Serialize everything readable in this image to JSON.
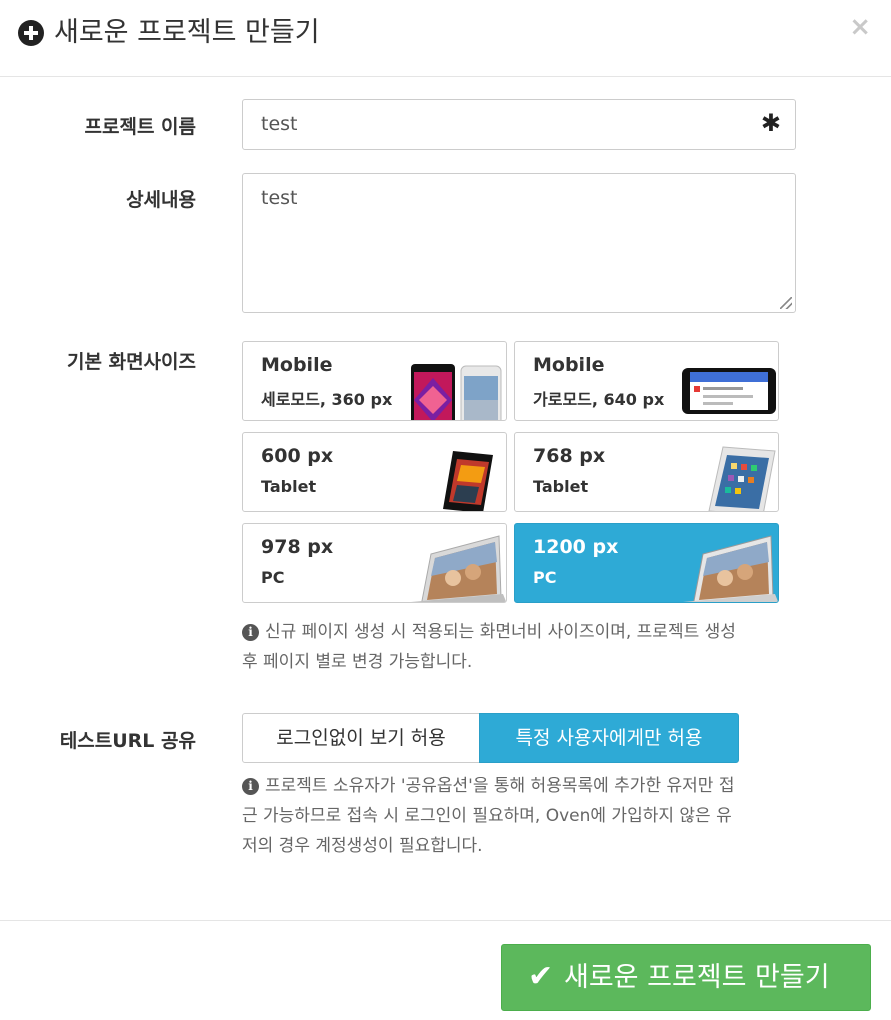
{
  "header": {
    "title": "새로운 프로젝트 만들기",
    "close": "×"
  },
  "fields": {
    "name": {
      "label": "프로젝트 이름",
      "value": "test",
      "required_mark": "✱"
    },
    "description": {
      "label": "상세내용",
      "value": "test"
    }
  },
  "screen_size": {
    "label": "기본 화면사이즈",
    "selected": "1200 px PC",
    "options": [
      {
        "title": "Mobile",
        "sub": "세로모드, 360 px",
        "icon": "phone-portrait-icon"
      },
      {
        "title": "Mobile",
        "sub": "가로모드, 640 px",
        "icon": "phone-landscape-icon"
      },
      {
        "title": "600 px",
        "sub": "Tablet",
        "icon": "tablet-small-icon"
      },
      {
        "title": "768 px",
        "sub": "Tablet",
        "icon": "tablet-icon"
      },
      {
        "title": "978 px",
        "sub": "PC",
        "icon": "laptop-icon"
      },
      {
        "title": "1200 px",
        "sub": "PC",
        "icon": "laptop-icon"
      }
    ],
    "help_lines": [
      "신규 페이지 생성 시 적용되는 화면너비 사이즈이며, 프로젝트 생성",
      "후 페이지 별로 변경 가능합니다."
    ]
  },
  "share": {
    "label": "테스트URL 공유",
    "option_public": "로그인없이 보기 허용",
    "option_restricted": "특정 사용자에게만 허용",
    "selected": "특정 사용자에게만 허용",
    "help_lines": [
      "프로젝트 소유자가 '공유옵션'을 통해 허용목록에 추가한 유저만 접",
      "근 가능하므로 접속 시 로그인이 필요하며, Oven에 가입하지 않은 유",
      "저의 경우 계정생성이 필요합니다."
    ]
  },
  "footer": {
    "submit_label": "새로운 프로젝트 만들기"
  },
  "colors": {
    "accent_blue": "#2eaad6",
    "success_green": "#5cb85c"
  }
}
